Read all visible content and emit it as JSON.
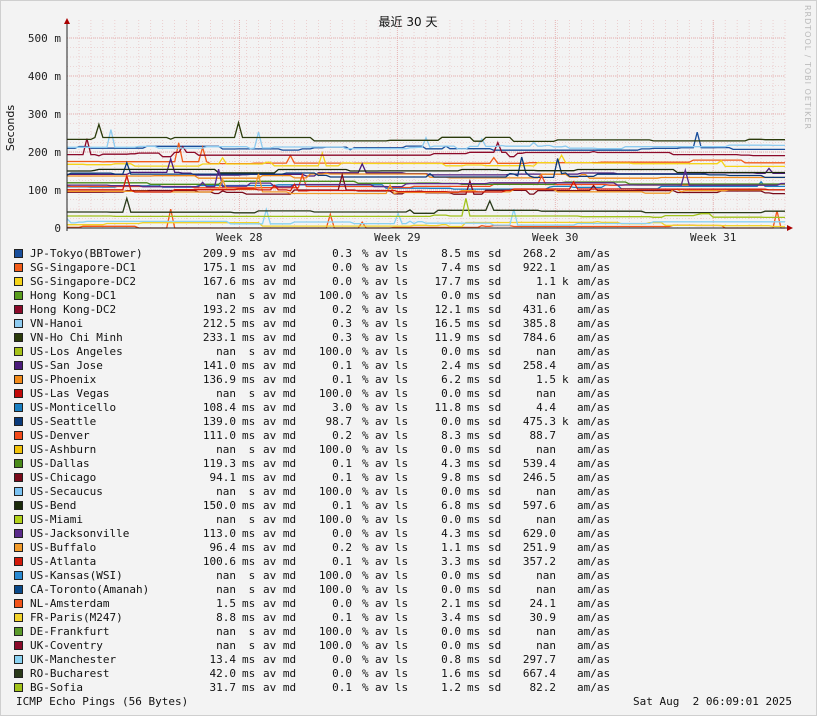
{
  "chart_data": {
    "type": "line",
    "title": "最近 30 天",
    "ylabel": "Seconds",
    "watermark": "RRDTOOL / TOBI OETIKER",
    "y_ticks": [
      "0",
      "100 m",
      "200 m",
      "300 m",
      "400 m",
      "500 m"
    ],
    "y_tick_values": [
      0,
      0.1,
      0.2,
      0.3,
      0.4,
      0.5
    ],
    "ylim": [
      0,
      0.5
    ],
    "x_ticks": [
      "Week 28",
      "Week 29",
      "Week 30",
      "Week 31"
    ],
    "x_tick_values": [
      0.24,
      0.46,
      0.68,
      0.9
    ],
    "xlim": [
      0,
      1
    ],
    "grid": true,
    "series": [
      {
        "name": "JP-Tokyo(BBTower)",
        "color": "#1a4f9c",
        "avg": "209.9",
        "avg_unit": "ms",
        "loss": "0.3",
        "sd": "8.5",
        "sd_unit": "ms",
        "max": "268.2",
        "max_unit": "",
        "level": 0.2099
      },
      {
        "name": "SG-Singapore-DC1",
        "color": "#f25c19",
        "avg": "175.1",
        "avg_unit": "ms",
        "loss": "0.0",
        "sd": "7.4",
        "sd_unit": "ms",
        "max": "922.1",
        "max_unit": "",
        "level": 0.1751
      },
      {
        "name": "SG-Singapore-DC2",
        "color": "#f5d41a",
        "avg": "167.6",
        "avg_unit": "ms",
        "loss": "0.0",
        "sd": "17.7",
        "sd_unit": "ms",
        "max": "1.1",
        "max_unit": "k",
        "level": 0.1676
      },
      {
        "name": "Hong Kong-DC1",
        "color": "#5a9e1f",
        "avg": "nan",
        "avg_unit": " s",
        "loss": "100.0",
        "sd": "0.0",
        "sd_unit": "ms",
        "max": "nan",
        "max_unit": "",
        "level": null
      },
      {
        "name": "Hong Kong-DC2",
        "color": "#8c0a2a",
        "avg": "193.2",
        "avg_unit": "ms",
        "loss": "0.2",
        "sd": "12.1",
        "sd_unit": "ms",
        "max": "431.6",
        "max_unit": "",
        "level": 0.1932
      },
      {
        "name": "VN-Hanoi",
        "color": "#8ecbf0",
        "avg": "212.5",
        "avg_unit": "ms",
        "loss": "0.3",
        "sd": "16.5",
        "sd_unit": "ms",
        "max": "385.8",
        "max_unit": "",
        "level": 0.2125
      },
      {
        "name": "VN-Ho Chi Minh",
        "color": "#2a3a0a",
        "avg": "233.1",
        "avg_unit": "ms",
        "loss": "0.3",
        "sd": "11.9",
        "sd_unit": "ms",
        "max": "784.6",
        "max_unit": "",
        "level": 0.2331
      },
      {
        "name": "US-Los Angeles",
        "color": "#a6c219",
        "avg": "nan",
        "avg_unit": " s",
        "loss": "100.0",
        "sd": "0.0",
        "sd_unit": "ms",
        "max": "nan",
        "max_unit": "",
        "level": null
      },
      {
        "name": "US-San Jose",
        "color": "#4a1a7a",
        "avg": "141.0",
        "avg_unit": "ms",
        "loss": "0.1",
        "sd": "2.4",
        "sd_unit": "ms",
        "max": "258.4",
        "max_unit": "",
        "level": 0.141
      },
      {
        "name": "US-Phoenix",
        "color": "#f28a1a",
        "avg": "136.9",
        "avg_unit": "ms",
        "loss": "0.1",
        "sd": "6.2",
        "sd_unit": "ms",
        "max": "1.5",
        "max_unit": "k",
        "level": 0.1369
      },
      {
        "name": "US-Las Vegas",
        "color": "#c20a0a",
        "avg": "nan",
        "avg_unit": " s",
        "loss": "100.0",
        "sd": "0.0",
        "sd_unit": "ms",
        "max": "nan",
        "max_unit": "",
        "level": null
      },
      {
        "name": "US-Monticello",
        "color": "#1a7fc2",
        "avg": "108.4",
        "avg_unit": "ms",
        "loss": "3.0",
        "sd": "11.8",
        "sd_unit": "ms",
        "max": "4.4",
        "max_unit": "",
        "level": 0.1084
      },
      {
        "name": "US-Seattle",
        "color": "#0a3a7a",
        "avg": "139.0",
        "avg_unit": "ms",
        "loss": "98.7",
        "sd": "0.0",
        "sd_unit": "ms",
        "max": "475.3",
        "max_unit": "k",
        "level": 0.139
      },
      {
        "name": "US-Denver",
        "color": "#f24a1a",
        "avg": "111.0",
        "avg_unit": "ms",
        "loss": "0.2",
        "sd": "8.3",
        "sd_unit": "ms",
        "max": "88.7",
        "max_unit": "",
        "level": 0.111
      },
      {
        "name": "US-Ashburn",
        "color": "#f2c20a",
        "avg": "nan",
        "avg_unit": " s",
        "loss": "100.0",
        "sd": "0.0",
        "sd_unit": "ms",
        "max": "nan",
        "max_unit": "",
        "level": null
      },
      {
        "name": "US-Dallas",
        "color": "#4a8a1a",
        "avg": "119.3",
        "avg_unit": "ms",
        "loss": "0.1",
        "sd": "4.3",
        "sd_unit": "ms",
        "max": "539.4",
        "max_unit": "",
        "level": 0.1193
      },
      {
        "name": "US-Chicago",
        "color": "#7a0a1a",
        "avg": "94.1",
        "avg_unit": "ms",
        "loss": "0.1",
        "sd": "9.8",
        "sd_unit": "ms",
        "max": "246.5",
        "max_unit": "",
        "level": 0.0941
      },
      {
        "name": "US-Secaucus",
        "color": "#7ac2f2",
        "avg": "nan",
        "avg_unit": " s",
        "loss": "100.0",
        "sd": "0.0",
        "sd_unit": "ms",
        "max": "nan",
        "max_unit": "",
        "level": null
      },
      {
        "name": "US-Bend",
        "color": "#1a2a0a",
        "avg": "150.0",
        "avg_unit": "ms",
        "loss": "0.1",
        "sd": "6.8",
        "sd_unit": "ms",
        "max": "597.6",
        "max_unit": "",
        "level": 0.15
      },
      {
        "name": "US-Miami",
        "color": "#b2d21a",
        "avg": "nan",
        "avg_unit": " s",
        "loss": "100.0",
        "sd": "0.0",
        "sd_unit": "ms",
        "max": "nan",
        "max_unit": "",
        "level": null
      },
      {
        "name": "US-Jacksonville",
        "color": "#5a2a8a",
        "avg": "113.0",
        "avg_unit": "ms",
        "loss": "0.0",
        "sd": "4.3",
        "sd_unit": "ms",
        "max": "629.0",
        "max_unit": "",
        "level": 0.113
      },
      {
        "name": "US-Buffalo",
        "color": "#f29a2a",
        "avg": "96.4",
        "avg_unit": "ms",
        "loss": "0.2",
        "sd": "1.1",
        "sd_unit": "ms",
        "max": "251.9",
        "max_unit": "",
        "level": 0.0964
      },
      {
        "name": "US-Atlanta",
        "color": "#d21a0a",
        "avg": "100.6",
        "avg_unit": "ms",
        "loss": "0.1",
        "sd": "3.3",
        "sd_unit": "ms",
        "max": "357.2",
        "max_unit": "",
        "level": 0.1006
      },
      {
        "name": "US-Kansas(WSI)",
        "color": "#2a8ad2",
        "avg": "nan",
        "avg_unit": " s",
        "loss": "100.0",
        "sd": "0.0",
        "sd_unit": "ms",
        "max": "nan",
        "max_unit": "",
        "level": null
      },
      {
        "name": "CA-Toronto(Amanah)",
        "color": "#0a4a8a",
        "avg": "nan",
        "avg_unit": " s",
        "loss": "100.0",
        "sd": "0.0",
        "sd_unit": "ms",
        "max": "nan",
        "max_unit": "",
        "level": null
      },
      {
        "name": "NL-Amsterdam",
        "color": "#f2541a",
        "avg": "1.5",
        "avg_unit": "ms",
        "loss": "0.0",
        "sd": "2.1",
        "sd_unit": "ms",
        "max": "24.1",
        "max_unit": "",
        "level": 0.0015
      },
      {
        "name": "FR-Paris(M247)",
        "color": "#f2d22a",
        "avg": "8.8",
        "avg_unit": "ms",
        "loss": "0.1",
        "sd": "3.4",
        "sd_unit": "ms",
        "max": "30.9",
        "max_unit": "",
        "level": 0.0088
      },
      {
        "name": "DE-Frankfurt",
        "color": "#5a9a2a",
        "avg": "nan",
        "avg_unit": " s",
        "loss": "100.0",
        "sd": "0.0",
        "sd_unit": "ms",
        "max": "nan",
        "max_unit": "",
        "level": null
      },
      {
        "name": "UK-Coventry",
        "color": "#8a0a2a",
        "avg": "nan",
        "avg_unit": " s",
        "loss": "100.0",
        "sd": "0.0",
        "sd_unit": "ms",
        "max": "nan",
        "max_unit": "",
        "level": null
      },
      {
        "name": "UK-Manchester",
        "color": "#8ad2f2",
        "avg": "13.4",
        "avg_unit": "ms",
        "loss": "0.0",
        "sd": "0.8",
        "sd_unit": "ms",
        "max": "297.7",
        "max_unit": "",
        "level": 0.0134
      },
      {
        "name": "RO-Bucharest",
        "color": "#2a3a1a",
        "avg": "42.0",
        "avg_unit": "ms",
        "loss": "0.0",
        "sd": "1.6",
        "sd_unit": "ms",
        "max": "667.4",
        "max_unit": "",
        "level": 0.042
      },
      {
        "name": "BG-Sofia",
        "color": "#a2c21a",
        "avg": "31.7",
        "avg_unit": "ms",
        "loss": "0.1",
        "sd": "1.2",
        "sd_unit": "ms",
        "max": "82.2",
        "max_unit": "",
        "level": 0.0317
      }
    ]
  },
  "labels": {
    "av_md": "av md",
    "av_ls": "av ls",
    "sd": "sd",
    "am_as": "am/as",
    "pct": "%"
  },
  "footer": {
    "left": "ICMP Echo Pings (56 Bytes)",
    "right": "Sat Aug  2 06:09:01 2025"
  }
}
